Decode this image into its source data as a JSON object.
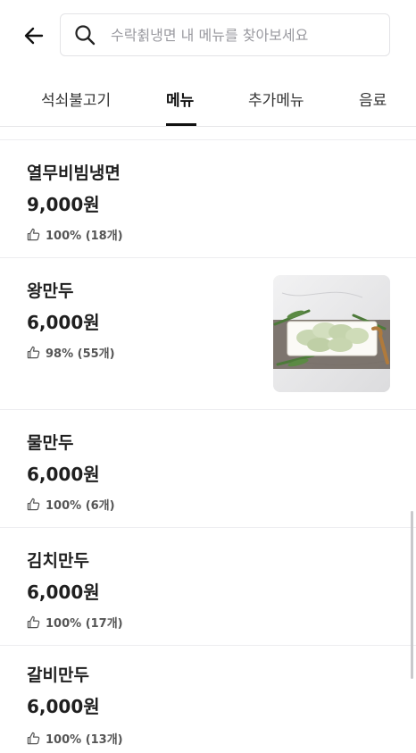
{
  "search": {
    "placeholder": "수락췱냉면 내 메뉴를 찾아보세요",
    "value": ""
  },
  "tabs": [
    {
      "label": "석쇠불고기",
      "active": false
    },
    {
      "label": "메뉴",
      "active": true
    },
    {
      "label": "추가메뉴",
      "active": false
    },
    {
      "label": "음료",
      "active": false
    }
  ],
  "menu_items": [
    {
      "name": "열무비빔냉면",
      "price": "9,000원",
      "rating": "100% (18개)",
      "has_photo": false
    },
    {
      "name": "왕만두",
      "price": "6,000원",
      "rating": "98% (55개)",
      "has_photo": true
    },
    {
      "name": "물만두",
      "price": "6,000원",
      "rating": "100% (6개)",
      "has_photo": false
    },
    {
      "name": "김치만두",
      "price": "6,000원",
      "rating": "100% (17개)",
      "has_photo": false
    },
    {
      "name": "갈비만두",
      "price": "6,000원",
      "rating": "100% (13개)",
      "has_photo": false
    }
  ],
  "icons": {
    "back": "back-arrow-icon",
    "search": "search-icon",
    "rating": "thumbs-up-icon"
  },
  "colors": {
    "text": "#1f1f1f",
    "divider": "#ededf0",
    "muted": "#9a9aa0"
  }
}
